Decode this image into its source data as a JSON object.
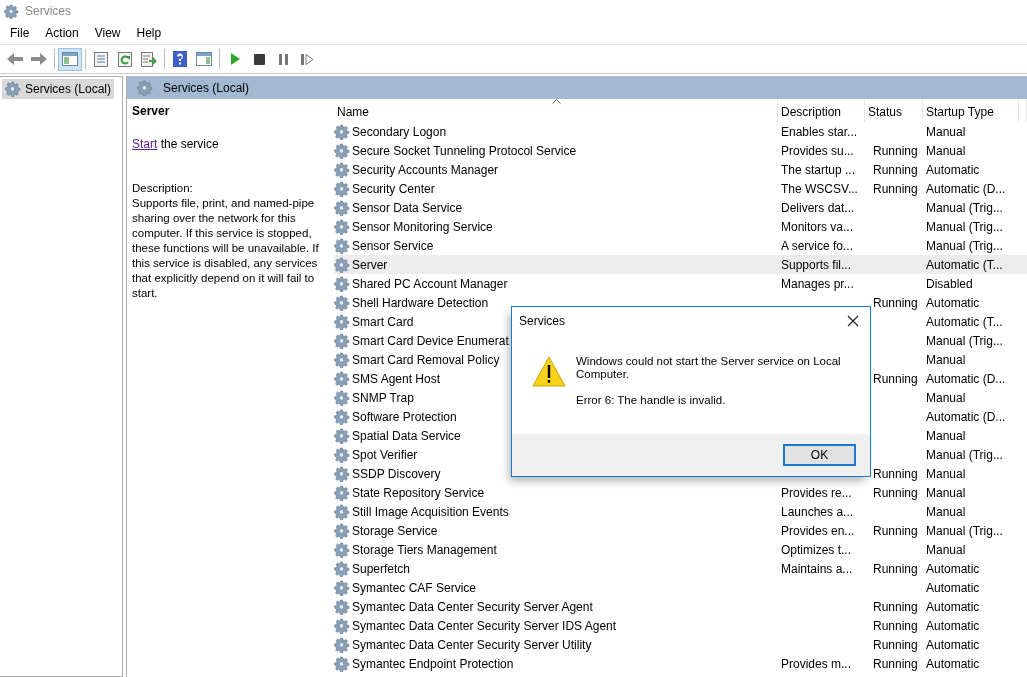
{
  "window": {
    "title": "Services"
  },
  "menu": [
    "File",
    "Action",
    "View",
    "Help"
  ],
  "toolbar": [
    [
      {
        "kind": "back",
        "pressed": false
      },
      {
        "kind": "forward",
        "pressed": false
      }
    ],
    [
      {
        "kind": "console-tree",
        "pressed": true
      }
    ],
    [
      {
        "kind": "properties",
        "pressed": false
      },
      {
        "kind": "refresh",
        "pressed": false
      },
      {
        "kind": "export",
        "pressed": false
      }
    ],
    [
      {
        "kind": "help",
        "pressed": false
      },
      {
        "kind": "action-pane",
        "pressed": false
      }
    ],
    [
      {
        "kind": "start",
        "pressed": false
      },
      {
        "kind": "stop",
        "pressed": false
      },
      {
        "kind": "pause",
        "pressed": false
      },
      {
        "kind": "resume",
        "pressed": false
      }
    ]
  ],
  "tree": {
    "items": [
      {
        "label": "Services (Local)",
        "selected": true
      }
    ]
  },
  "pane_header": {
    "title": "Services (Local)"
  },
  "details": {
    "title": "Server",
    "action_link": "Start",
    "action_text": " the service",
    "description_label": "Description:",
    "description": "Supports file, print, and named-pipe sharing over the network for this computer. If this service is stopped, these functions will be unavailable. If this service is disabled, any services that explicitly depend on it will fail to start."
  },
  "table": {
    "columns": [
      {
        "label": "Name",
        "sorted": true
      },
      {
        "label": "Description",
        "sorted": false
      },
      {
        "label": "Status",
        "sorted": false
      },
      {
        "label": "Startup Type",
        "sorted": false
      }
    ],
    "rows": [
      {
        "name": "Secondary Logon",
        "description": "Enables star...",
        "startup": "Manual",
        "selected": false
      },
      {
        "name": "Secure Socket Tunneling Protocol Service",
        "description": "Provides su...",
        "status": "Running",
        "startup": "Manual",
        "selected": false
      },
      {
        "name": "Security Accounts Manager",
        "description": "The startup ...",
        "status": "Running",
        "startup": "Automatic",
        "selected": false
      },
      {
        "name": "Security Center",
        "description": "The WSCSV...",
        "status": "Running",
        "startup": "Automatic (D...",
        "selected": false
      },
      {
        "name": "Sensor Data Service",
        "description": "Delivers dat...",
        "startup": "Manual (Trig...",
        "selected": false
      },
      {
        "name": "Sensor Monitoring Service",
        "description": "Monitors va...",
        "startup": "Manual (Trig...",
        "selected": false
      },
      {
        "name": "Sensor Service",
        "description": "A service fo...",
        "startup": "Manual (Trig...",
        "selected": false
      },
      {
        "name": "Server",
        "description": "Supports fil...",
        "startup": "Automatic (T...",
        "selected": true
      },
      {
        "name": "Shared PC Account Manager",
        "description": "Manages pr...",
        "startup": "Disabled",
        "selected": false
      },
      {
        "name": "Shell Hardware Detection",
        "status": "Running",
        "startup": "Automatic",
        "selected": false
      },
      {
        "name": "Smart Card",
        "startup": "Automatic (T...",
        "selected": false
      },
      {
        "name": "Smart Card Device Enumerat",
        "startup": "Manual (Trig...",
        "selected": false
      },
      {
        "name": "Smart Card Removal Policy",
        "startup": "Manual",
        "selected": false
      },
      {
        "name": "SMS Agent Host",
        "status": "Running",
        "startup": "Automatic (D...",
        "selected": false
      },
      {
        "name": "SNMP Trap",
        "startup": "Manual",
        "selected": false
      },
      {
        "name": "Software Protection",
        "startup": "Automatic (D...",
        "selected": false
      },
      {
        "name": "Spatial Data Service",
        "startup": "Manual",
        "selected": false
      },
      {
        "name": "Spot Verifier",
        "startup": "Manual (Trig...",
        "selected": false
      },
      {
        "name": "SSDP Discovery",
        "status": "Running",
        "startup": "Manual",
        "selected": false
      },
      {
        "name": "State Repository Service",
        "description": "Provides re...",
        "status": "Running",
        "startup": "Manual",
        "selected": false
      },
      {
        "name": "Still Image Acquisition Events",
        "description": "Launches a...",
        "startup": "Manual",
        "selected": false
      },
      {
        "name": "Storage Service",
        "description": "Provides en...",
        "status": "Running",
        "startup": "Manual (Trig...",
        "selected": false
      },
      {
        "name": "Storage Tiers Management",
        "description": "Optimizes t...",
        "startup": "Manual",
        "selected": false
      },
      {
        "name": "Superfetch",
        "description": "Maintains a...",
        "status": "Running",
        "startup": "Automatic",
        "selected": false
      },
      {
        "name": "Symantec CAF Service",
        "startup": "Automatic",
        "selected": false
      },
      {
        "name": "Symantec Data Center Security Server Agent",
        "status": "Running",
        "startup": "Automatic",
        "selected": false
      },
      {
        "name": "Symantec Data Center Security Server IDS Agent",
        "status": "Running",
        "startup": "Automatic",
        "selected": false
      },
      {
        "name": "Symantec Data Center Security Server Utility",
        "status": "Running",
        "startup": "Automatic",
        "selected": false
      },
      {
        "name": "Symantec Endpoint Protection",
        "description": "Provides m...",
        "status": "Running",
        "startup": "Automatic",
        "selected": false
      }
    ]
  },
  "dialog": {
    "title": "Services",
    "message": "Windows could not start the Server service on Local Computer.",
    "error": "Error 6: The handle is invalid.",
    "button": "OK"
  }
}
